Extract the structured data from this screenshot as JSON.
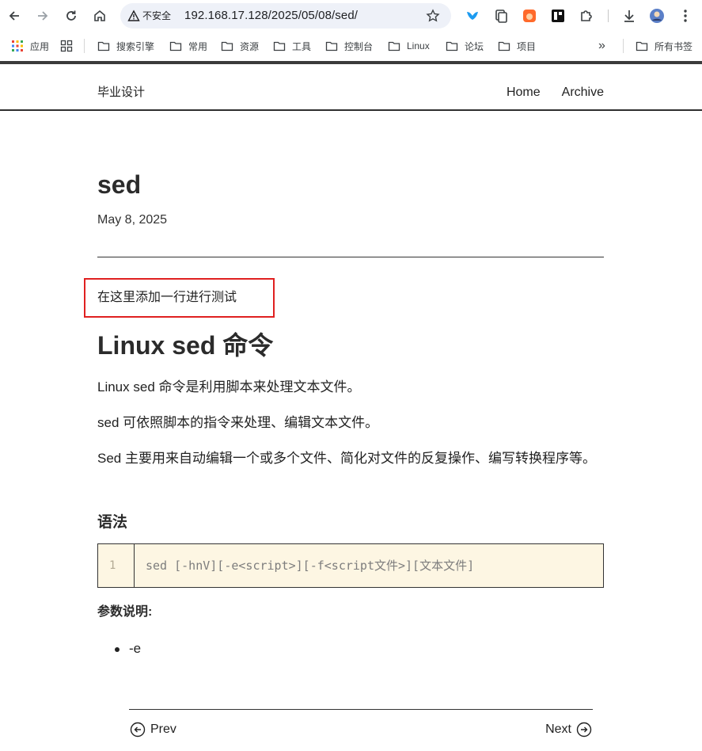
{
  "browser": {
    "address": {
      "insecure_label": "不安全",
      "url": "192.168.17.128/2025/05/08/sed/"
    },
    "bookmarks": {
      "apps_label": "应用",
      "items": [
        {
          "label": "搜索引擎"
        },
        {
          "label": "常用"
        },
        {
          "label": "资源"
        },
        {
          "label": "工具"
        },
        {
          "label": "控制台"
        },
        {
          "label": "Linux"
        },
        {
          "label": "论坛"
        },
        {
          "label": "项目"
        }
      ],
      "overflow_label": "»",
      "all_bookmarks_label": "所有书签"
    },
    "icons": [
      "back-icon",
      "forward-icon",
      "reload-icon",
      "home-icon",
      "warning-icon",
      "star-icon",
      "bird-extension-icon",
      "copy-extension-icon",
      "fire-extension-icon",
      "reader-extension-icon",
      "puzzle-icon",
      "download-icon",
      "avatar",
      "menu-icon"
    ]
  },
  "site": {
    "title": "毕业设计",
    "nav": [
      {
        "label": "Home"
      },
      {
        "label": "Archive"
      }
    ]
  },
  "post": {
    "title": "sed",
    "date": "May 8, 2025",
    "added_line": "在这里添加一行进行测试",
    "heading": "Linux sed 命令",
    "paragraphs": [
      "Linux sed 命令是利用脚本来处理文本文件。",
      "sed 可依照脚本的指令来处理、编辑文本文件。",
      "Sed 主要用来自动编辑一个或多个文件、简化对文件的反复操作、编写转换程序等。"
    ],
    "syntax_heading": "语法",
    "code": {
      "line_number": "1",
      "text": "sed [-hnV][-e<script>][-f<script文件>][文本文件]"
    },
    "params_label": "参数说明:",
    "bullets": [
      "-e"
    ]
  },
  "pager": {
    "prev_label": "Prev",
    "next_label": "Next"
  },
  "colors": {
    "highlight_border": "#e02020",
    "code_background": "#fdf6e3"
  }
}
